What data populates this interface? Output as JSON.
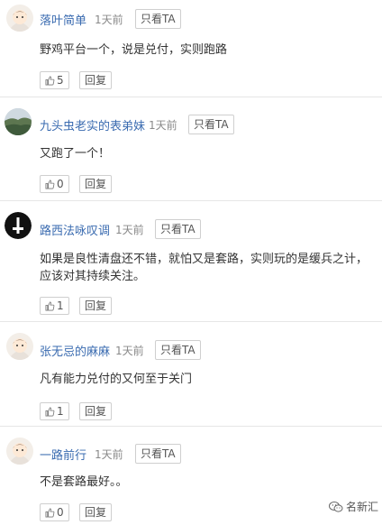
{
  "ui": {
    "ta_label": "只看TA",
    "reply_label": "回复"
  },
  "comments": [
    {
      "user": "落叶简单",
      "time": "1天前",
      "text": "野鸡平台一个，说是兑付，实则跑路",
      "likes": "5"
    },
    {
      "user": "九头虫老实的表弟妹",
      "time": "1天前",
      "text": "又跑了一个！",
      "likes": "0"
    },
    {
      "user": "路西法咏叹调",
      "time": "1天前",
      "text": "如果是良性清盘还不错，就怕又是套路，实则玩的是缓兵之计，应该对其持续关注。",
      "likes": "1"
    },
    {
      "user": "张无忌的麻麻",
      "time": "1天前",
      "text": "凡有能力兑付的又何至于关门",
      "likes": "1"
    },
    {
      "user": "一路前行",
      "time": "1天前",
      "text": "不是套路最好。。",
      "likes": "0"
    }
  ],
  "watermark": "名新汇",
  "icons": {
    "avatar_cartoon": "cartoon-avatar-icon",
    "avatar_landscape": "landscape-avatar-icon",
    "avatar_cross": "inverted-cross-avatar-icon",
    "like": "thumb-up-icon",
    "wechat": "wechat-icon"
  },
  "colors": {
    "username": "#3a6bb0",
    "meta": "#8a8a8a",
    "divider": "#e6e6e6",
    "text": "#333333"
  }
}
